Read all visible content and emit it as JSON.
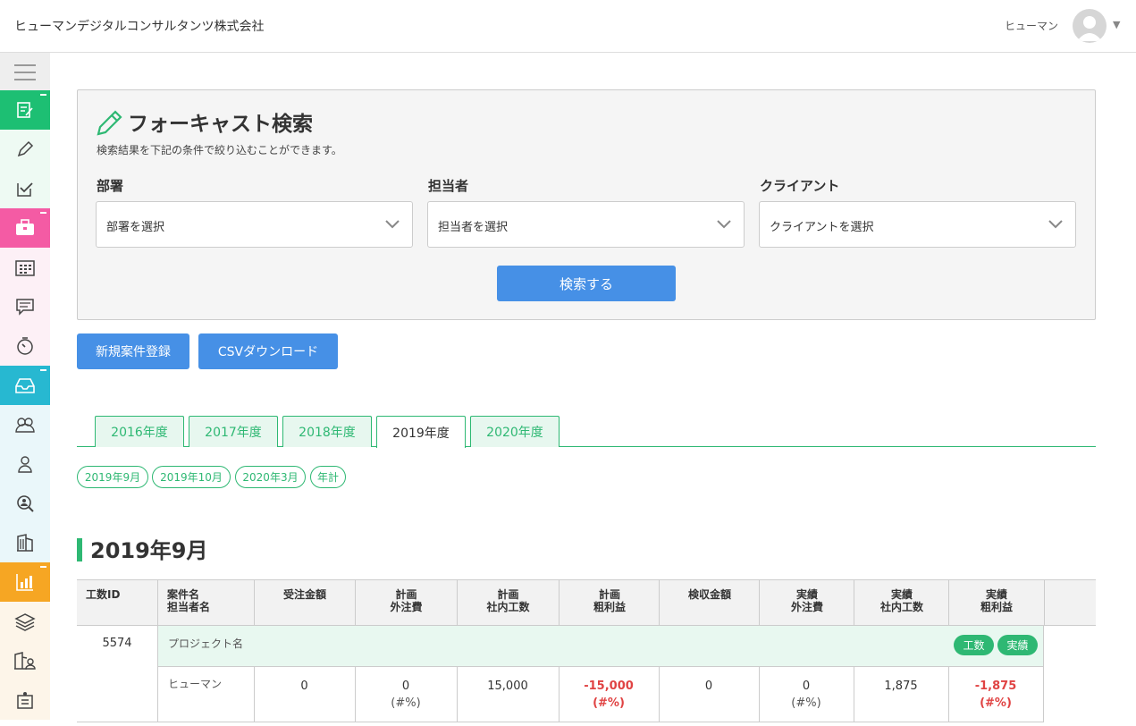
{
  "header": {
    "company": "ヒューマンデジタルコンサルタンツ株式会社",
    "user_name": "ヒューマン"
  },
  "sidebar": {
    "items": [
      {
        "icon": "menu-icon",
        "bg": "#eeeeee"
      },
      {
        "icon": "edit-list-icon",
        "bg": "#1dbf73",
        "active": true
      },
      {
        "icon": "pencil-icon",
        "bg": "#eefaf3"
      },
      {
        "icon": "checklist-icon",
        "bg": "#eefaf3"
      },
      {
        "icon": "briefcase-icon",
        "bg": "#f45ba4",
        "active": true
      },
      {
        "icon": "calendar-icon",
        "bg": "#fdf0f6"
      },
      {
        "icon": "message-icon",
        "bg": "#fdf0f6"
      },
      {
        "icon": "timer-icon",
        "bg": "#fdf0f6"
      },
      {
        "icon": "inbox-icon",
        "bg": "#27b8d1",
        "active": true
      },
      {
        "icon": "group-icon",
        "bg": "#eaf7fa"
      },
      {
        "icon": "person-icon",
        "bg": "#eaf7fa"
      },
      {
        "icon": "user-search-icon",
        "bg": "#eaf7fa"
      },
      {
        "icon": "building-icon",
        "bg": "#eaf7fa"
      },
      {
        "icon": "bar-chart-icon",
        "bg": "#f6a623",
        "active": true
      },
      {
        "icon": "layers-icon",
        "bg": "#fdf5e9"
      },
      {
        "icon": "building-user-icon",
        "bg": "#fdf5e9"
      },
      {
        "icon": "org-chart-icon",
        "bg": "#fdf5e9"
      }
    ]
  },
  "search": {
    "title": "フォーキャスト検索",
    "description": "検索結果を下記の条件で絞り込むことができます。",
    "fields": [
      {
        "label": "部署",
        "placeholder": "部署を選択"
      },
      {
        "label": "担当者",
        "placeholder": "担当者を選択"
      },
      {
        "label": "クライアント",
        "placeholder": "クライアントを選択"
      }
    ],
    "submit": "検索する"
  },
  "actions": {
    "new": "新規案件登録",
    "csv": "CSVダウンロード"
  },
  "years": [
    "2016年度",
    "2017年度",
    "2018年度",
    "2019年度",
    "2020年度"
  ],
  "active_year": "2019年度",
  "months": [
    "2019年9月",
    "2019年10月",
    "2020年3月",
    "年計"
  ],
  "section_title": "2019年9月",
  "table": {
    "headers": [
      [
        "工数ID",
        ""
      ],
      [
        "案件名",
        "担当者名"
      ],
      [
        "受注金額",
        ""
      ],
      [
        "計画",
        "外注費"
      ],
      [
        "計画",
        "社内工数"
      ],
      [
        "計画",
        "粗利益"
      ],
      [
        "検収金額",
        ""
      ],
      [
        "実績",
        "外注費"
      ],
      [
        "実績",
        "社内工数"
      ],
      [
        "実績",
        "粗利益"
      ]
    ],
    "row": {
      "id": "5574",
      "project": "プロジェクト名",
      "badges": [
        "工数",
        "実績"
      ],
      "person": "ヒューマン",
      "order": "0",
      "plan_out": "0",
      "plan_out_pct": "(#%)",
      "plan_in": "15,000",
      "plan_profit": "-15,000",
      "plan_profit_pct": "(#%)",
      "accept": "0",
      "act_out": "0",
      "act_out_pct": "(#%)",
      "act_in": "1,875",
      "act_profit": "-1,875",
      "act_profit_pct": "(#%)"
    }
  }
}
